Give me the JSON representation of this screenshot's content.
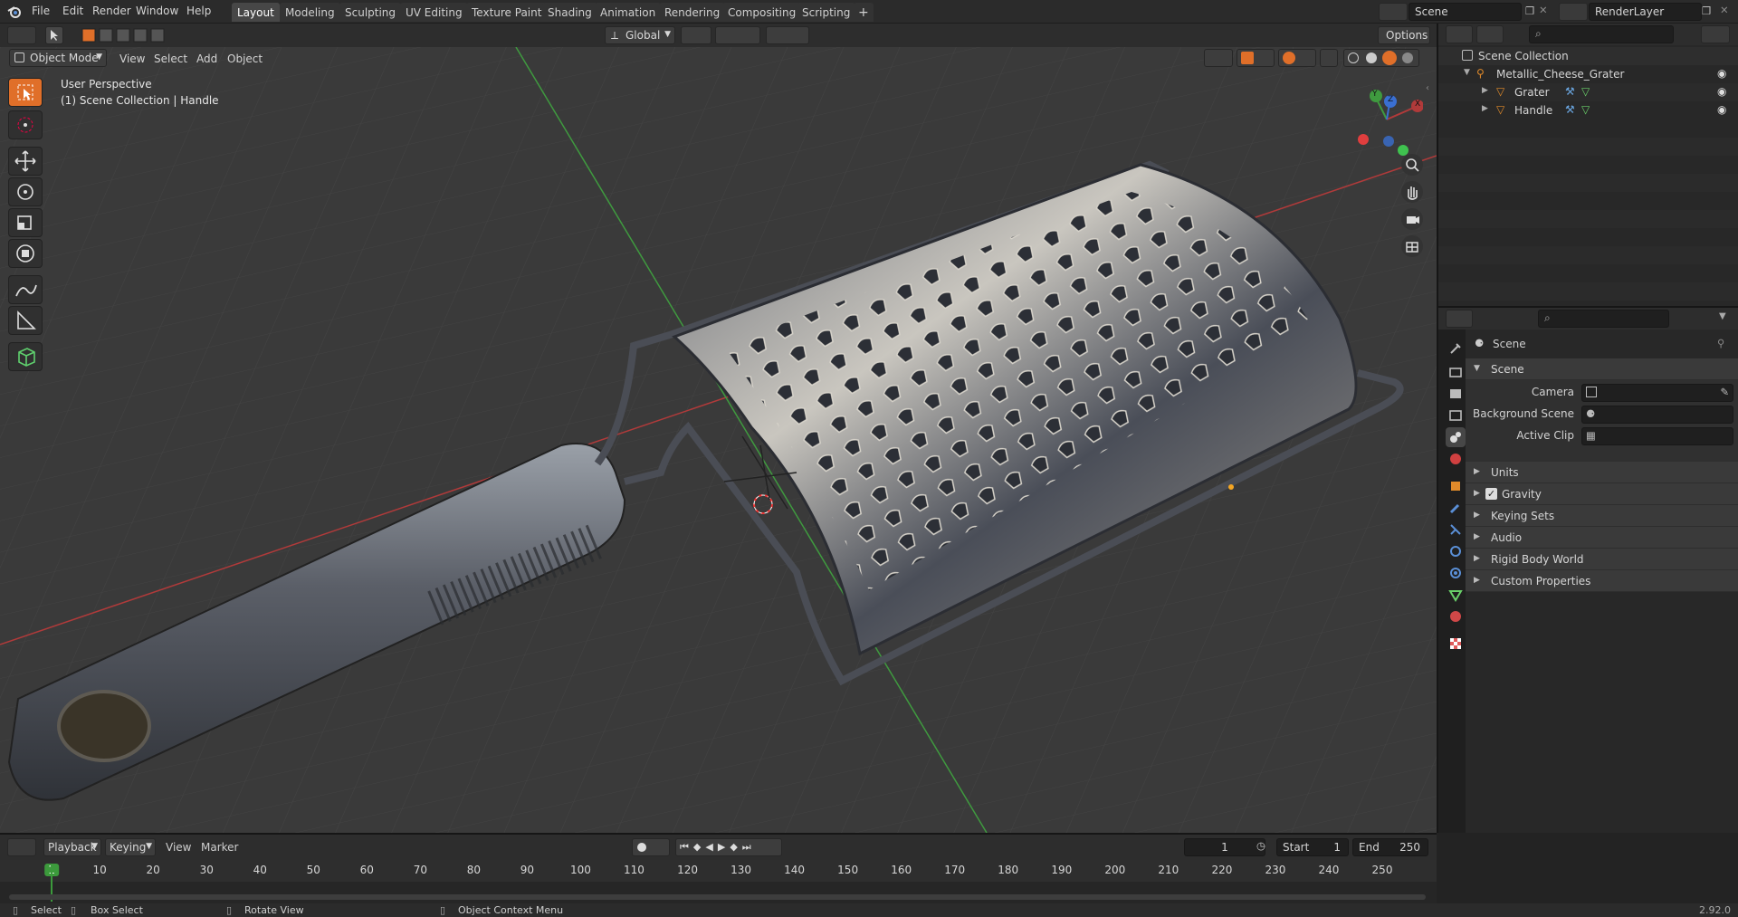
{
  "app": {
    "menu": [
      "File",
      "Edit",
      "Render",
      "Window",
      "Help"
    ],
    "workspaces": [
      "Layout",
      "Modeling",
      "Sculpting",
      "UV Editing",
      "Texture Paint",
      "Shading",
      "Animation",
      "Rendering",
      "Compositing",
      "Scripting"
    ],
    "active_workspace": "Layout",
    "add_workspace": "+",
    "scene_name": "Scene",
    "view_layer": "RenderLayer",
    "version": "2.92.0"
  },
  "viewport_header": {
    "mode": "Object Mode",
    "menus": [
      "View",
      "Select",
      "Add",
      "Object"
    ],
    "orientation": "Global",
    "options": "Options"
  },
  "viewport": {
    "overlay_line1": "User Perspective",
    "overlay_line2": "(1) Scene Collection | Handle",
    "gizmo": {
      "x": "X",
      "y": "Y",
      "z": "Z"
    }
  },
  "outliner": {
    "root": "Scene Collection",
    "collection": "Metallic_Cheese_Grater",
    "objects": [
      "Grater",
      "Handle"
    ]
  },
  "properties": {
    "header": "Scene",
    "panel": "Scene",
    "fields": {
      "camera": "Camera",
      "background_scene": "Background Scene",
      "active_clip": "Active Clip"
    },
    "sections": [
      "Units",
      "Gravity",
      "Keying Sets",
      "Audio",
      "Rigid Body World",
      "Custom Properties"
    ],
    "gravity_checked": true
  },
  "timeline": {
    "menus": [
      "Playback",
      "Keying",
      "View",
      "Marker"
    ],
    "current_frame": "1",
    "start_label": "Start",
    "start": "1",
    "end_label": "End",
    "end": "250",
    "ticks": [
      "1",
      "10",
      "20",
      "30",
      "40",
      "50",
      "60",
      "70",
      "80",
      "90",
      "100",
      "110",
      "120",
      "130",
      "140",
      "150",
      "160",
      "170",
      "180",
      "190",
      "200",
      "210",
      "220",
      "230",
      "240",
      "250"
    ]
  },
  "status_bar": {
    "select": "Select",
    "box_select": "Box Select",
    "rotate_view": "Rotate View",
    "context_menu": "Object Context Menu"
  },
  "colors": {
    "accent": "#e06f29",
    "x_axis": "#b13a3a",
    "y_axis": "#3f9a3f",
    "z_axis": "#3a6fd1",
    "current_frame": "#3c9a3c"
  }
}
